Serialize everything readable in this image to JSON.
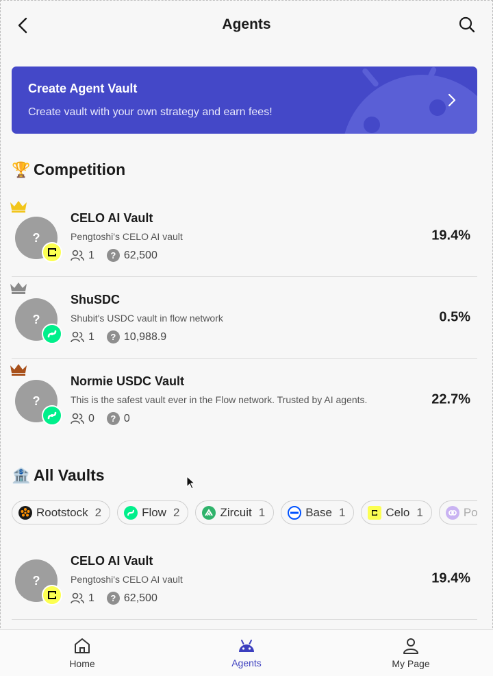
{
  "header": {
    "title": "Agents"
  },
  "banner": {
    "title": "Create Agent Vault",
    "subtitle": "Create vault with your own strategy and earn fees!"
  },
  "competition": {
    "emoji": "🏆",
    "title": "Competition",
    "vaults": [
      {
        "rank_crown_color": "#f2c51a",
        "avatar": "?",
        "chain": "celo",
        "name": "CELO AI Vault",
        "description": "Pengtoshi's CELO AI vault",
        "members": "1",
        "tvl": "62,500",
        "apy": "19.4%"
      },
      {
        "rank_crown_color": "#8a8a8a",
        "avatar": "?",
        "chain": "flow",
        "name": "ShuSDC",
        "description": "Shubit's USDC vault in flow network",
        "members": "1",
        "tvl": "10,988.9",
        "apy": "0.5%"
      },
      {
        "rank_crown_color": "#a8501a",
        "avatar": "?",
        "chain": "flow",
        "name": "Normie USDC Vault",
        "description": "This is the safest vault ever in the Flow network. Trusted by AI agents.",
        "members": "0",
        "tvl": "0",
        "apy": "22.7%"
      }
    ]
  },
  "all_vaults": {
    "emoji": "🏦",
    "title": "All Vaults",
    "filters": [
      {
        "label": "Rootstock",
        "count": "2",
        "icon": "rootstock-icon",
        "color": "#ff9100"
      },
      {
        "label": "Flow",
        "count": "2",
        "icon": "flow-icon",
        "color": "#00ef8b"
      },
      {
        "label": "Zircuit",
        "count": "1",
        "icon": "zircuit-icon",
        "color": "#2fb36b"
      },
      {
        "label": "Base",
        "count": "1",
        "icon": "base-icon",
        "color": "#0052ff"
      },
      {
        "label": "Celo",
        "count": "1",
        "icon": "celo-icon",
        "color": "#fcff52"
      },
      {
        "label": "Polygon",
        "count": "",
        "icon": "polygon-icon",
        "color": "#8247e5"
      }
    ],
    "vaults": [
      {
        "avatar": "?",
        "chain": "celo",
        "name": "CELO AI Vault",
        "description": "Pengtoshi's CELO AI vault",
        "members": "1",
        "tvl": "62,500",
        "apy": "19.4%"
      }
    ]
  },
  "tabbar": {
    "home": "Home",
    "agents": "Agents",
    "mypage": "My Page"
  },
  "colors": {
    "accent": "#3c3fbf",
    "banner": "#4448c8"
  }
}
